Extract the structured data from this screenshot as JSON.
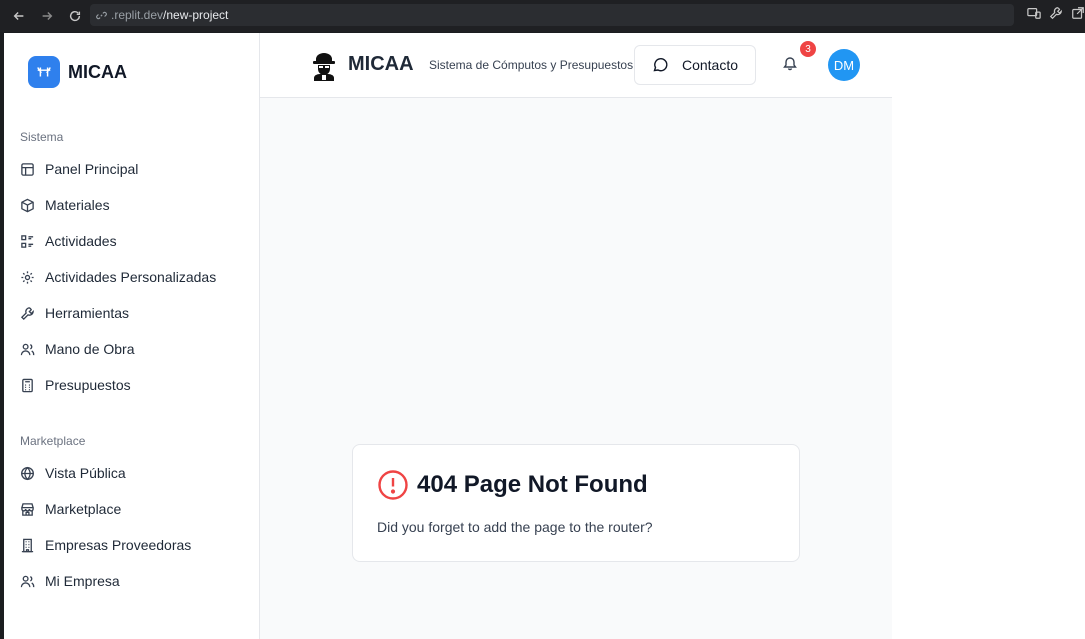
{
  "browser": {
    "url_host": ".replit.dev",
    "url_path": "/new-project"
  },
  "sidebar": {
    "brand": "MICAA",
    "sections": [
      {
        "label": "Sistema",
        "items": [
          {
            "label": "Panel Principal",
            "icon": "layout-icon"
          },
          {
            "label": "Materiales",
            "icon": "package-icon"
          },
          {
            "label": "Actividades",
            "icon": "activities-icon"
          },
          {
            "label": "Actividades Personalizadas",
            "icon": "gear-icon"
          },
          {
            "label": "Herramientas",
            "icon": "wrench-icon"
          },
          {
            "label": "Mano de Obra",
            "icon": "users-icon"
          },
          {
            "label": "Presupuestos",
            "icon": "calculator-icon"
          }
        ]
      },
      {
        "label": "Marketplace",
        "items": [
          {
            "label": "Vista Pública",
            "icon": "globe-icon"
          },
          {
            "label": "Marketplace",
            "icon": "store-icon"
          },
          {
            "label": "Empresas Proveedoras",
            "icon": "building-icon"
          },
          {
            "label": "Mi Empresa",
            "icon": "users-icon"
          }
        ]
      }
    ]
  },
  "header": {
    "title": "MICAA",
    "subtitle": "Sistema de Cómputos y Presupuestos",
    "contact_label": "Contacto",
    "notification_count": "3",
    "avatar_initials": "DM"
  },
  "error_card": {
    "title": "404 Page Not Found",
    "message": "Did you forget to add the page to the router?"
  },
  "colors": {
    "accent": "#2f80ed",
    "avatar": "#2196f3",
    "error": "#ef4444"
  }
}
